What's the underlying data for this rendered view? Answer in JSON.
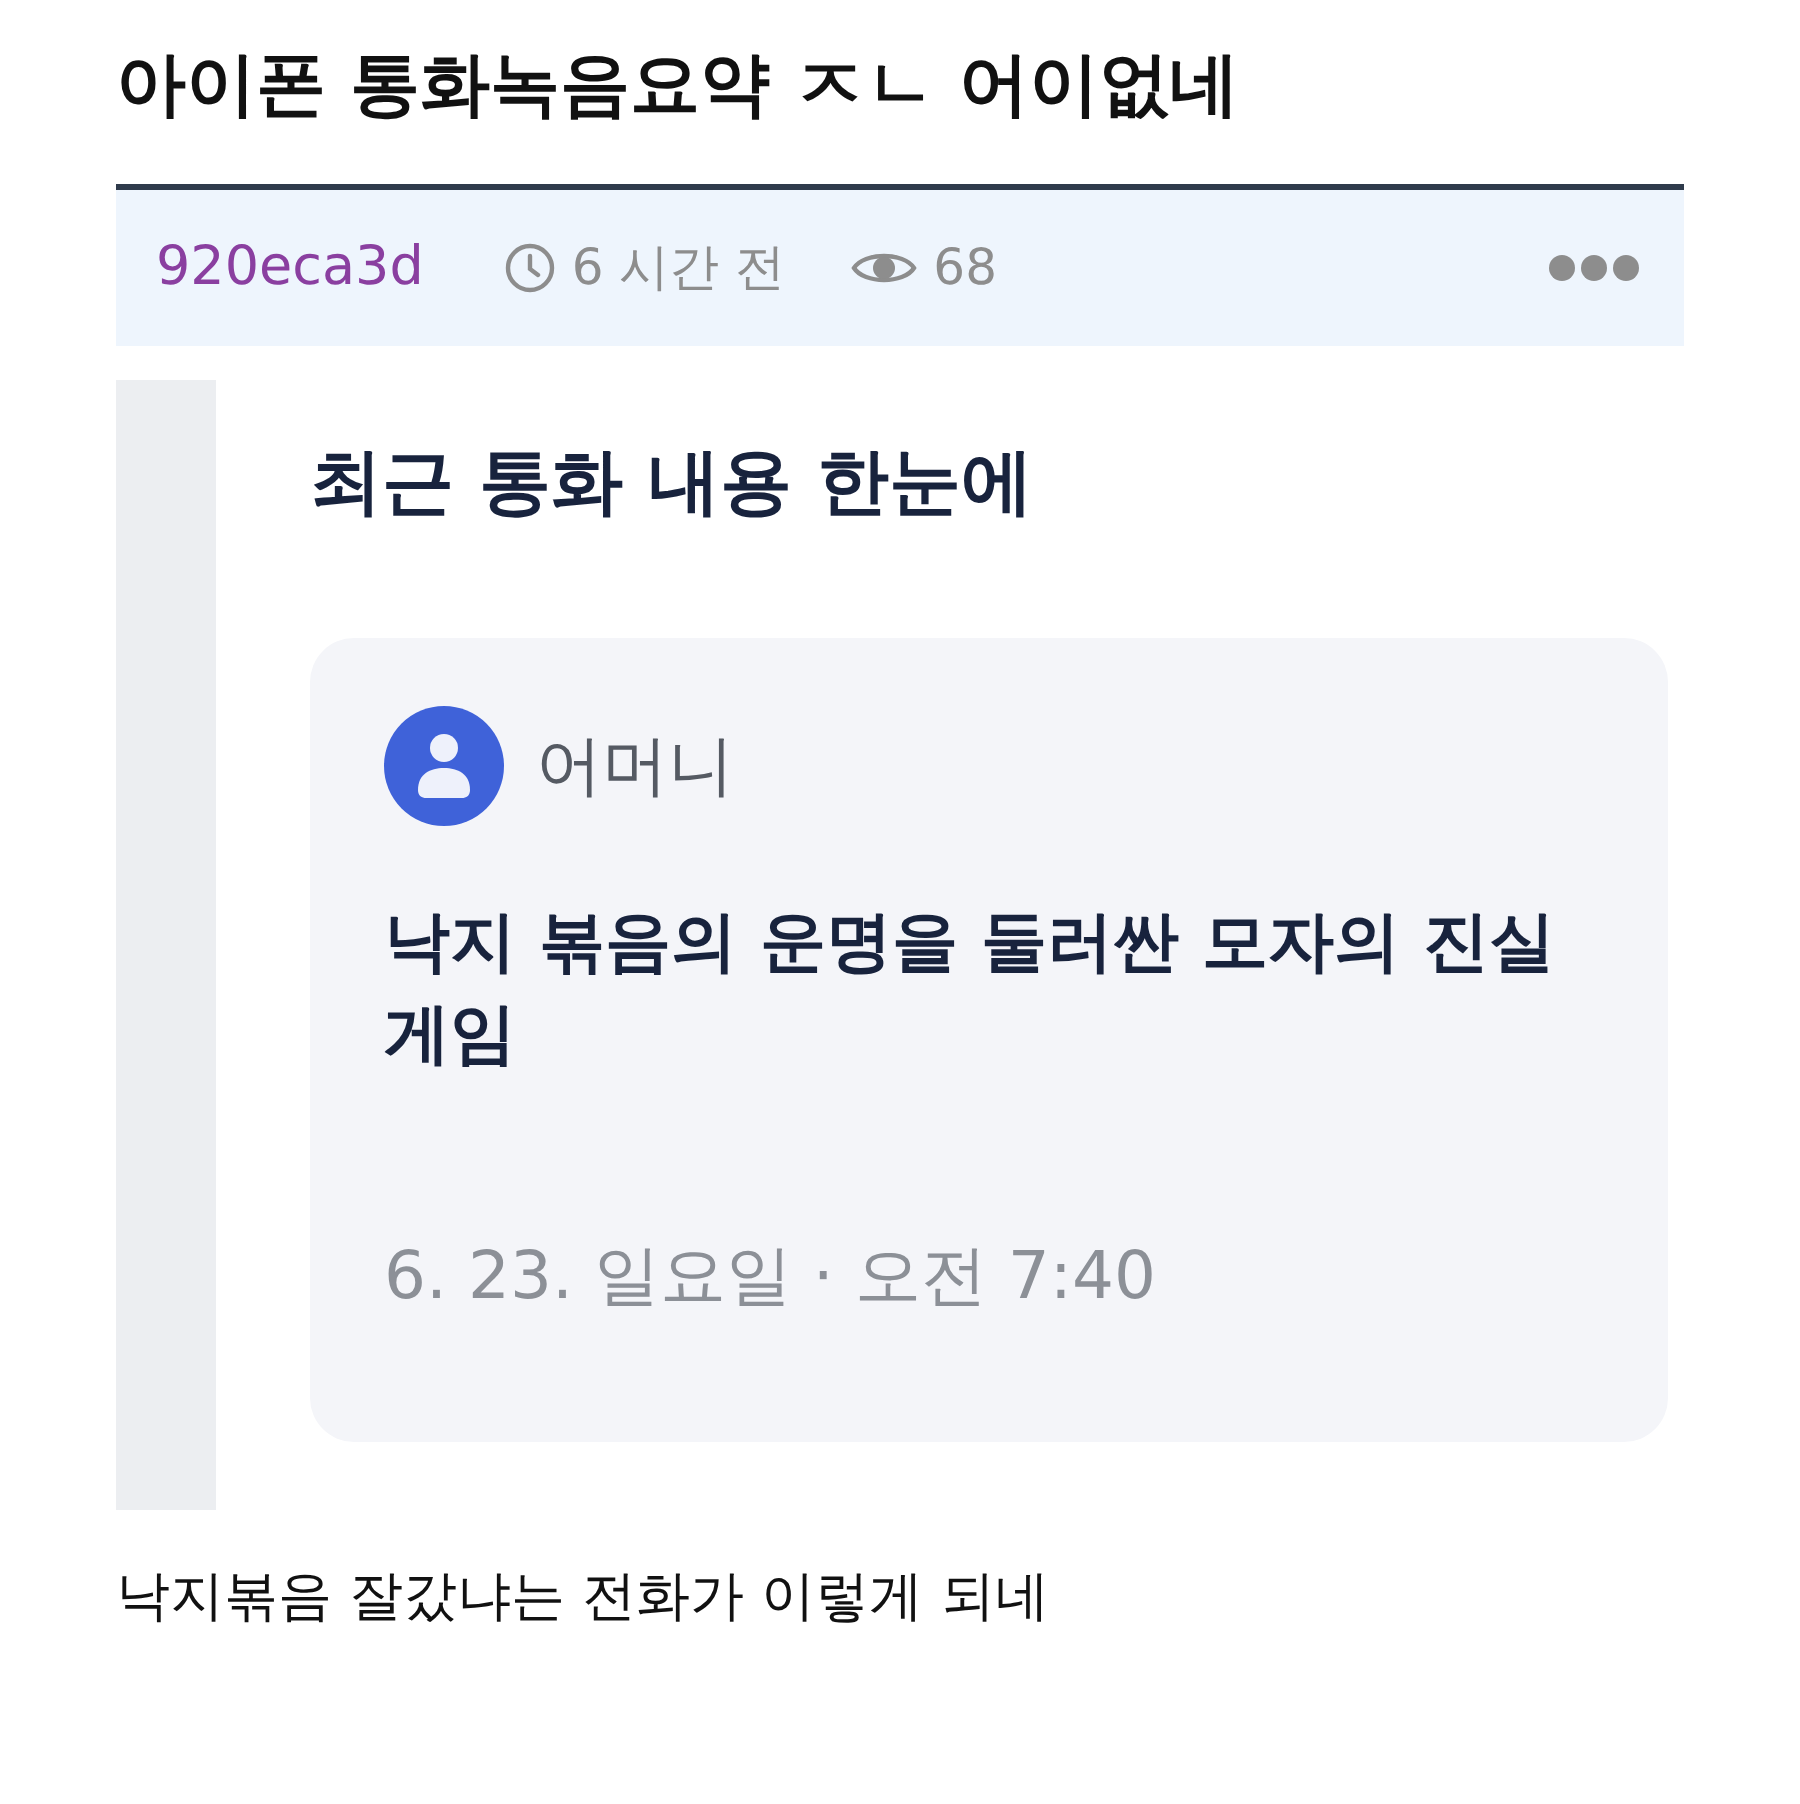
{
  "title": "아이폰 통화녹음요약 ㅈㄴ 어이없네",
  "post_meta": {
    "author": "920eca3d",
    "time": "6 시간 전",
    "views": "68"
  },
  "screenshot": {
    "heading": "최근 통화 내용 한눈에",
    "call_summary": {
      "contact": "어머니",
      "summary": "낙지 볶음의 운명을 둘러싼 모자의 진실 게임",
      "date": "6. 23. 일요일 · 오전 7:40"
    }
  },
  "caption": "낙지볶음 잘갔냐는 전화가 이렇게 되네"
}
